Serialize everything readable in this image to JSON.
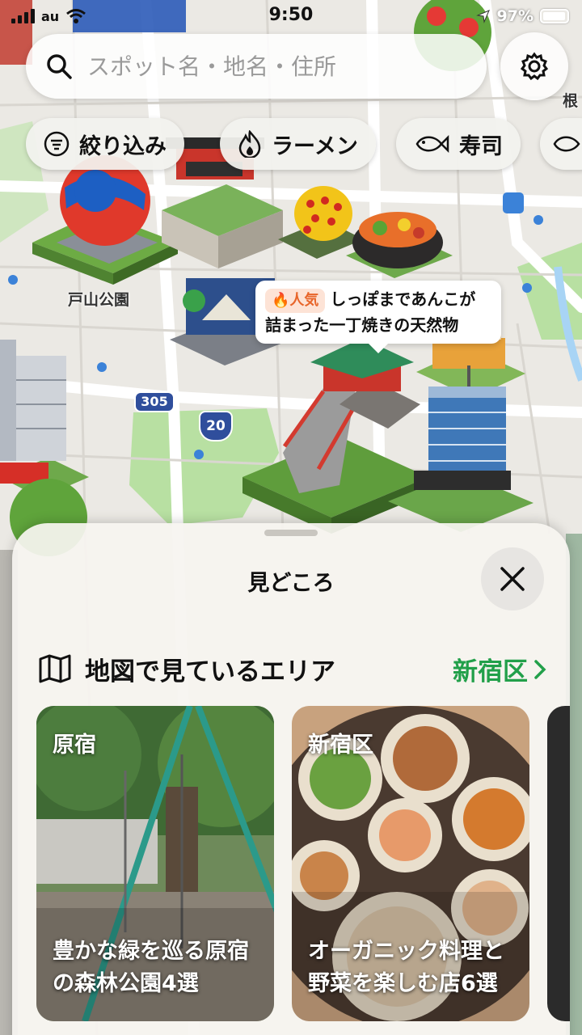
{
  "status_bar": {
    "carrier": "au",
    "time": "9:50",
    "battery": "97%"
  },
  "search": {
    "placeholder": "スポット名・地名・住所"
  },
  "filters": [
    {
      "label": "絞り込み",
      "icon": "filter-icon"
    },
    {
      "label": "ラーメン",
      "icon": "flame-icon"
    },
    {
      "label": "寿司",
      "icon": "fish-icon"
    }
  ],
  "map": {
    "labels": {
      "park": "戸山公園",
      "route_305": "305",
      "route_20": "20",
      "edge": "根"
    },
    "callout": {
      "badge": "人気",
      "text_line1": "しっぽまであんこが",
      "text_line2": "詰まった一丁焼きの天然物"
    },
    "colors": {
      "water": "#a8d4f5",
      "park": "#b8e0a2",
      "road": "#ffffff",
      "route_badge": "#2f4e9c"
    }
  },
  "sheet": {
    "title": "見どころ",
    "section_title": "地図で見ているエリア",
    "area_link": "新宿区",
    "cards": [
      {
        "area": "原宿",
        "title": "豊かな緑を巡る原宿の森林公園4選"
      },
      {
        "area": "新宿区",
        "title": "オーガニック料理と野菜を楽しむ店6選"
      }
    ],
    "accent_color": "#22a04a"
  }
}
